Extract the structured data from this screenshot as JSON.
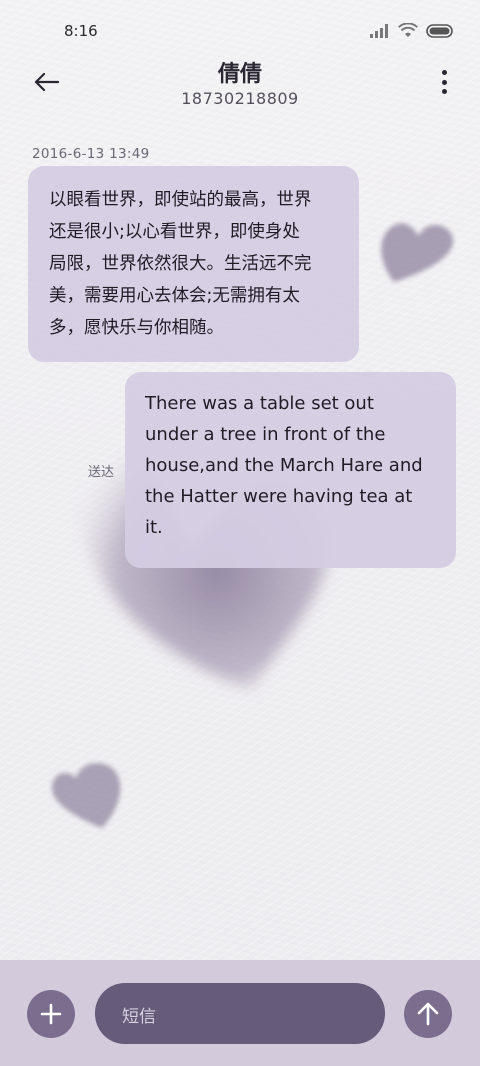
{
  "status_bar": {
    "time": "8:16",
    "icons": [
      "signal-icon",
      "wifi-icon",
      "battery-icon"
    ]
  },
  "header": {
    "contact_name": "倩倩",
    "phone_number": "18730218809",
    "back_icon": "back-arrow-icon",
    "more_icon": "more-vertical-icon"
  },
  "conversation": {
    "timestamp": "2016-6-13 13:49",
    "messages": [
      {
        "direction": "incoming",
        "lines": [
          "以眼看世界，即使站的最高，世界",
          "还是很小;以心看世界，即使身处",
          "局限，世界依然很大。生活远不完",
          "美，需要用心去体会;无需拥有太",
          "多，愿快乐与你相随。"
        ]
      },
      {
        "direction": "outgoing",
        "status": "送达",
        "lines": [
          "There was a table set out",
          "under a tree in front of the",
          "house,and the March Hare and",
          "the Hatter were having tea at",
          "it."
        ]
      }
    ]
  },
  "composer": {
    "add_icon": "plus-icon",
    "placeholder": "短信",
    "send_icon": "send-arrow-icon"
  },
  "colors": {
    "bubble": "#d5cde2",
    "composer_bar": "#d3cadc",
    "input": "#665b79",
    "round_button": "#7a6d8d",
    "heart": "#8f839f"
  }
}
